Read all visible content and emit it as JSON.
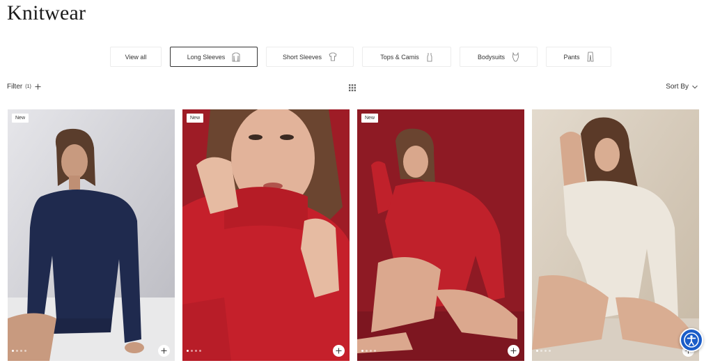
{
  "page": {
    "title": "Knitwear"
  },
  "categories": [
    {
      "label": "View all",
      "icon": "none",
      "active": false
    },
    {
      "label": "Long Sleeves",
      "icon": "long-sleeve-top-icon",
      "active": true
    },
    {
      "label": "Short Sleeves",
      "icon": "short-sleeve-top-icon",
      "active": false
    },
    {
      "label": "Tops & Camis",
      "icon": "cami-icon",
      "active": false
    },
    {
      "label": "Bodysuits",
      "icon": "bodysuit-icon",
      "active": false
    },
    {
      "label": "Pants",
      "icon": "pants-icon",
      "active": false
    }
  ],
  "toolbar": {
    "filter_label": "Filter",
    "filter_count": "(1)",
    "sort_label": "Sort By"
  },
  "products": [
    {
      "badge": "New",
      "image_colors": {
        "bg": "#cfcfd3",
        "garment": "#1f2a4e"
      }
    },
    {
      "badge": "New",
      "image_colors": {
        "bg": "#9e1c26",
        "garment": "#c5202b"
      }
    },
    {
      "badge": "New",
      "image_colors": {
        "bg": "#8e1a24",
        "garment": "#c0212b"
      }
    },
    {
      "badge": "",
      "image_colors": {
        "bg": "#d6cbbb",
        "garment": "#ece6dc"
      }
    }
  ],
  "accessibility": {
    "icon": "accessibility-icon",
    "color": "#1a5cc8"
  }
}
